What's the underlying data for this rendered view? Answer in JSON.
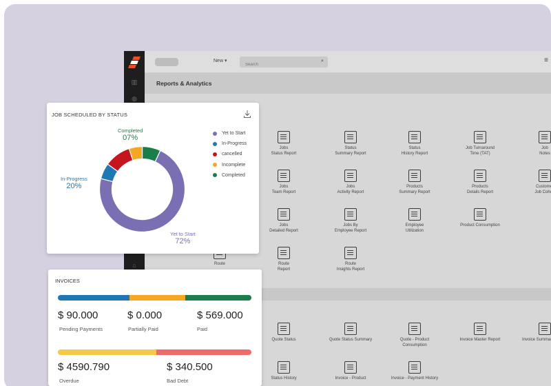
{
  "app": {
    "new_label": "New",
    "search_placeholder": "Search",
    "section_title": "Reports & Analytics"
  },
  "reports": [
    {
      "label": "Jobs\nStatus Report",
      "icon": "clipboard-list-icon"
    },
    {
      "label": "Status\nSummary Report",
      "icon": "checklist-icon"
    },
    {
      "label": "Status\nHistory Report",
      "icon": "history-icon"
    },
    {
      "label": "Job Turnaround\nTime (TAT)",
      "icon": "stopwatch-icon"
    },
    {
      "label": "Job\nNotes",
      "icon": "notes-icon"
    },
    {
      "label": "Jobs\nTeam Report",
      "icon": "team-icon"
    },
    {
      "label": "Jobs\nActivity Report",
      "icon": "activity-icon"
    },
    {
      "label": "Products\nSummary Report",
      "icon": "sparkle-icon"
    },
    {
      "label": "Products\nDetails Report",
      "icon": "cart-report-icon"
    },
    {
      "label": "Customer\nJob Cohort",
      "icon": "cohort-icon"
    },
    {
      "label": "Jobs\nDetailed Report",
      "icon": "checklist-icon"
    },
    {
      "label": "Jobs By\nEmployee Report",
      "icon": "employee-icon"
    },
    {
      "label": "Employee\nUtilization",
      "icon": "utilization-icon"
    },
    {
      "label": "Product Consumption",
      "icon": "clipboard-list-icon"
    },
    {
      "label": "Route",
      "icon": "route-icon"
    },
    {
      "label": "Route\nReport",
      "icon": "route-icon"
    },
    {
      "label": "Route\nInsights Report",
      "icon": "route-insights-icon"
    }
  ],
  "invoice_reports": [
    {
      "label": "Quote Status",
      "icon": "clipboard-list-icon"
    },
    {
      "label": "Quote Status Summary",
      "icon": "checklist-icon"
    },
    {
      "label": "Quote - Product\nConsumption",
      "icon": "clipboard-list-icon"
    },
    {
      "label": "Invoice Master Report",
      "icon": "search-report-icon"
    },
    {
      "label": "Invoice Summary Report",
      "icon": "checklist-icon"
    },
    {
      "label": "Status History",
      "icon": "clipboard-list-icon"
    },
    {
      "label": "Invoice - Product",
      "icon": "sparkle-icon"
    },
    {
      "label": "Invoice - Payment History",
      "icon": "clipboard-list-icon"
    }
  ],
  "job_status": {
    "title": "JOB SCHEDULED BY STATUS",
    "legend": [
      "Yet to Start",
      "In-Progress",
      "cancelled",
      "Incomplete",
      "Completed"
    ],
    "colors": {
      "yet_to_start": "#7b6fb3",
      "in_progress": "#1f78b4",
      "cancelled": "#c4161c",
      "incomplete": "#f5a623",
      "completed": "#1a7d4a"
    },
    "labels": {
      "completed": {
        "name": "Completed",
        "pct": "07%"
      },
      "in_progress": {
        "name": "In-Progress",
        "pct": "20%"
      },
      "yet_to_start": {
        "name": "Yet to Start",
        "pct": "72%"
      }
    }
  },
  "chart_data": {
    "type": "pie",
    "title": "JOB SCHEDULED BY STATUS",
    "categories": [
      "Yet to Start",
      "In-Progress",
      "cancelled",
      "Incomplete",
      "Completed"
    ],
    "values": [
      72,
      6,
      10,
      5,
      7
    ]
  },
  "invoices": {
    "title": "INVOICES",
    "bar1_colors": [
      "#1f78b4",
      "#f5a623",
      "#1a7d4a"
    ],
    "bar1_fractions": [
      0.37,
      0.29,
      0.34
    ],
    "bar2_colors": [
      "#f7c948",
      "#ef6b6b"
    ],
    "bar2_fractions": [
      0.51,
      0.49
    ],
    "pending": {
      "amount": "$ 90.000",
      "label": "Pending Payments"
    },
    "partial": {
      "amount": "$ 0.000",
      "label": "Partially Paid"
    },
    "paid": {
      "amount": "$ 569.000",
      "label": "Paid"
    },
    "overdue": {
      "amount": "$ 4590.790",
      "label": "Overdue"
    },
    "bad_debt": {
      "amount": "$ 340.500",
      "label": "Bad Debt"
    }
  }
}
